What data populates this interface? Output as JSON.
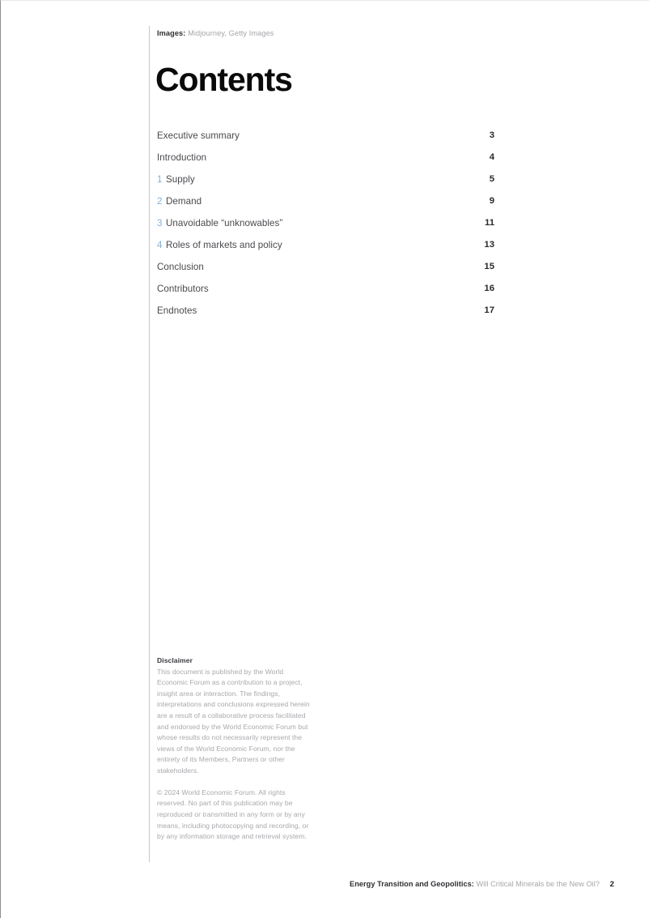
{
  "document": {
    "title": "Contents",
    "credit": {
      "label": "Images:",
      "value": "Midjourney, Getty Images"
    },
    "accent_color": "#86b0d6",
    "rule_color": "#c9c9cd"
  },
  "toc": {
    "entries": [
      {
        "number": "",
        "label": "Executive summary",
        "page": "3"
      },
      {
        "number": "",
        "label": "Introduction",
        "page": "4"
      },
      {
        "number": "1",
        "label": "Supply",
        "page": "5"
      },
      {
        "number": "2",
        "label": "Demand",
        "page": "9"
      },
      {
        "number": "3",
        "label": "Unavoidable “unknowables”",
        "page": "11"
      },
      {
        "number": "4",
        "label": "Roles of markets and policy",
        "page": "13"
      },
      {
        "number": "",
        "label": "Conclusion",
        "page": "15"
      },
      {
        "number": "",
        "label": "Contributors",
        "page": "16"
      },
      {
        "number": "",
        "label": "Endnotes",
        "page": "17"
      }
    ]
  },
  "disclaimer": {
    "heading": "Disclaimer",
    "body": "This document is published by the World Economic Forum as a contribution to a project, insight area or interaction. The findings, interpretations and conclusions expressed herein are a result of a collaborative process facilitated and endorsed by the World Economic Forum but whose results do not necessarily represent the views of the World Economic Forum, nor the entirety of its Members, Partners or other stakeholders.",
    "copyright": "© 2024 World Economic Forum. All rights reserved. No part of this publication may be reproduced or transmitted in any form or by any means, including photocopying and recording, or by any information storage and retrieval system."
  },
  "footer": {
    "title_strong": "Energy Transition and Geopolitics:",
    "title_light": "Will Critical Minerals be the New Oil?",
    "page_number": "2"
  }
}
